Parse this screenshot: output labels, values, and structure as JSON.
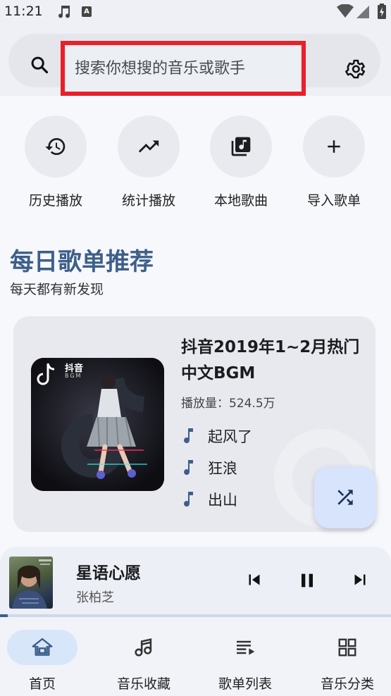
{
  "status": {
    "time": "11:21"
  },
  "search": {
    "placeholder": "搜索你想搜的音乐或歌手"
  },
  "quick_actions": [
    {
      "label": "历史播放",
      "icon": "history-icon"
    },
    {
      "label": "统计播放",
      "icon": "trending-up-icon"
    },
    {
      "label": "本地歌曲",
      "icon": "music-library-icon"
    },
    {
      "label": "导入歌单",
      "icon": "plus-icon"
    }
  ],
  "daily": {
    "title": "每日歌单推荐",
    "subtitle": "每天都有新发现"
  },
  "playlist": {
    "title": "抖音2019年1~2月热门中文BGM",
    "plays": "播放量：524.5万",
    "cover_text": "抖音",
    "cover_sub": "BGM",
    "songs": [
      "起风了",
      "狂浪",
      "出山"
    ]
  },
  "player": {
    "title": "星语心愿",
    "artist": "张柏芝",
    "progress": 0.02
  },
  "nav": [
    {
      "label": "首页",
      "icon": "home-icon",
      "active": true
    },
    {
      "label": "音乐收藏",
      "icon": "music-note-icon",
      "active": false
    },
    {
      "label": "歌单列表",
      "icon": "playlist-icon",
      "active": false
    },
    {
      "label": "音乐分类",
      "icon": "category-icon",
      "active": false
    }
  ],
  "colors": {
    "accent": "#3d5f8a",
    "highlight": "#e8202a",
    "nav_active": "#d8e6fa"
  }
}
